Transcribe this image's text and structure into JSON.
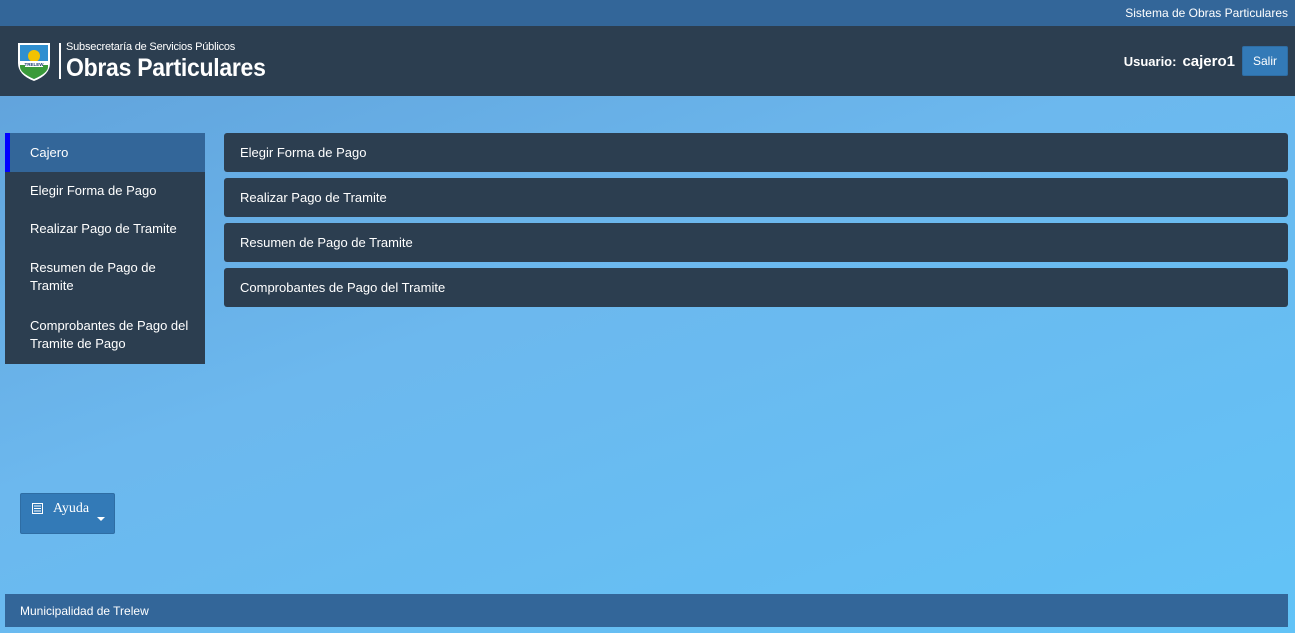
{
  "topbar": {
    "system_name": "Sistema de Obras Particulares"
  },
  "header": {
    "subtitle": "Subsecretaría de Servicios Públicos",
    "title": "Obras Particulares",
    "logo_text": "TRELEW",
    "user_label": "Usuario:",
    "user_name": "cajero1",
    "logout_label": "Salir"
  },
  "sidebar": {
    "items": [
      {
        "label": "Cajero",
        "active": true
      },
      {
        "label": "Elegir Forma de Pago"
      },
      {
        "label": "Realizar Pago de Tramite"
      },
      {
        "label": "Resumen de Pago de Tramite"
      },
      {
        "label": "Comprobantes de Pago del Tramite de Pago"
      }
    ]
  },
  "main": {
    "panels": [
      {
        "label": "Elegir Forma de Pago"
      },
      {
        "label": "Realizar Pago de Tramite"
      },
      {
        "label": "Resumen de Pago de Tramite"
      },
      {
        "label": "Comprobantes de Pago del Tramite"
      }
    ]
  },
  "help": {
    "label": "Ayuda",
    "icon": "list-icon"
  },
  "footer": {
    "text": "Municipalidad de Trelew"
  },
  "colors": {
    "header_bg": "#2c3e50",
    "bar_bg": "#336699",
    "button_bg": "#337ab7",
    "active_marker": "#0000ff"
  }
}
